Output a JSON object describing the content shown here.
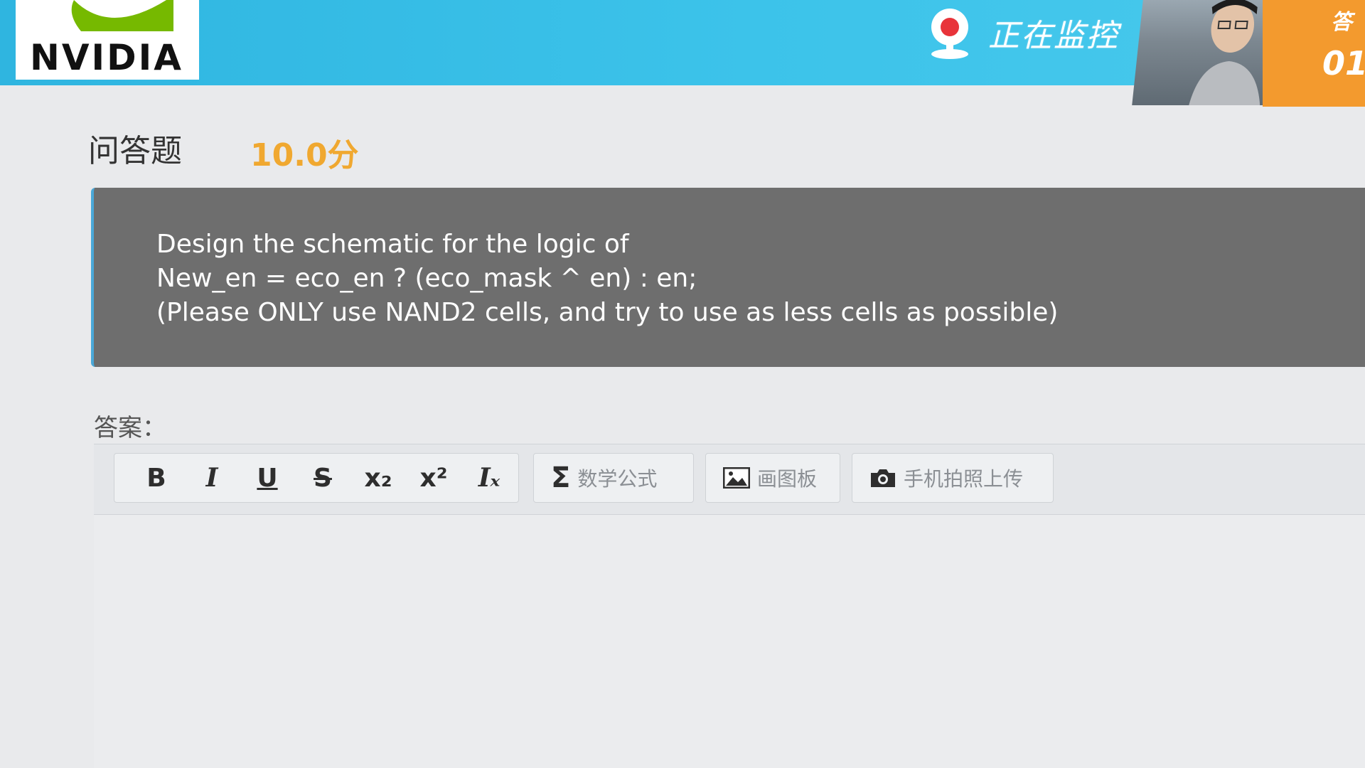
{
  "header": {
    "logo_text": "NVIDIA",
    "monitor_status": "正在监控",
    "timer_label": "答",
    "timer_value": "01"
  },
  "question": {
    "type_label": "问答题",
    "score": "10.0分",
    "lines": [
      "Design the schematic for the logic of",
      "New_en = eco_en ? (eco_mask ^ en) : en;",
      "(Please ONLY use NAND2 cells, and try to use as less cells as possible)"
    ]
  },
  "answer": {
    "label": "答案：",
    "toolbar": {
      "bold": "B",
      "italic": "I",
      "underline": "U",
      "strike": "S",
      "subscript": "x",
      "subscript_mark": "₂",
      "superscript": "x",
      "superscript_mark": "²",
      "clear_format": "I",
      "clear_format_mark": "ₓ",
      "math_icon": "Σ",
      "math_label": "数学公式",
      "draw_label": "画图板",
      "photo_label": "手机拍照上传"
    }
  },
  "icons": [
    "nvidia-logo",
    "webcam-monitor-icon",
    "sigma-icon",
    "image-icon",
    "camera-icon"
  ],
  "colors": {
    "header_bg": "#3cc3ea",
    "timer_bg": "#f39a2e",
    "score": "#f0a830",
    "question_bg": "#6e6e6e",
    "question_accent": "#4aa8d8"
  }
}
